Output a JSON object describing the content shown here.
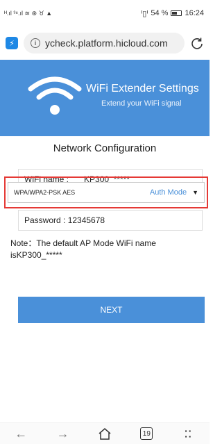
{
  "status_bar": {
    "left_indicators": "ᴴ.ıl ³⁶.ıl ≋ ⊛ ♉ ▲",
    "vibrate": "ᑊ▯ᑊ",
    "battery_text": "54 %",
    "time": "16:24"
  },
  "browser": {
    "url": "ycheck.platform.hicloud.com",
    "tab_count": "19"
  },
  "header": {
    "title": "WiFi Extender Settings",
    "subtitle": "Extend your WiFi signal",
    "color": "#4a90d9"
  },
  "form": {
    "section_title": "Network Configuration",
    "wifi_name_label": "WiFi name :",
    "wifi_name_value": "KP300_*****",
    "security_mode": "WPA/WPA2-PSK AES",
    "auth_mode_label": "Auth Mode",
    "password_text": "Password : 12345678",
    "note_line1": "Note：The default AP Mode WiFi name",
    "note_line2": "isKP300_*****",
    "next_label": "NEXT"
  },
  "highlight_color": "#e53935"
}
